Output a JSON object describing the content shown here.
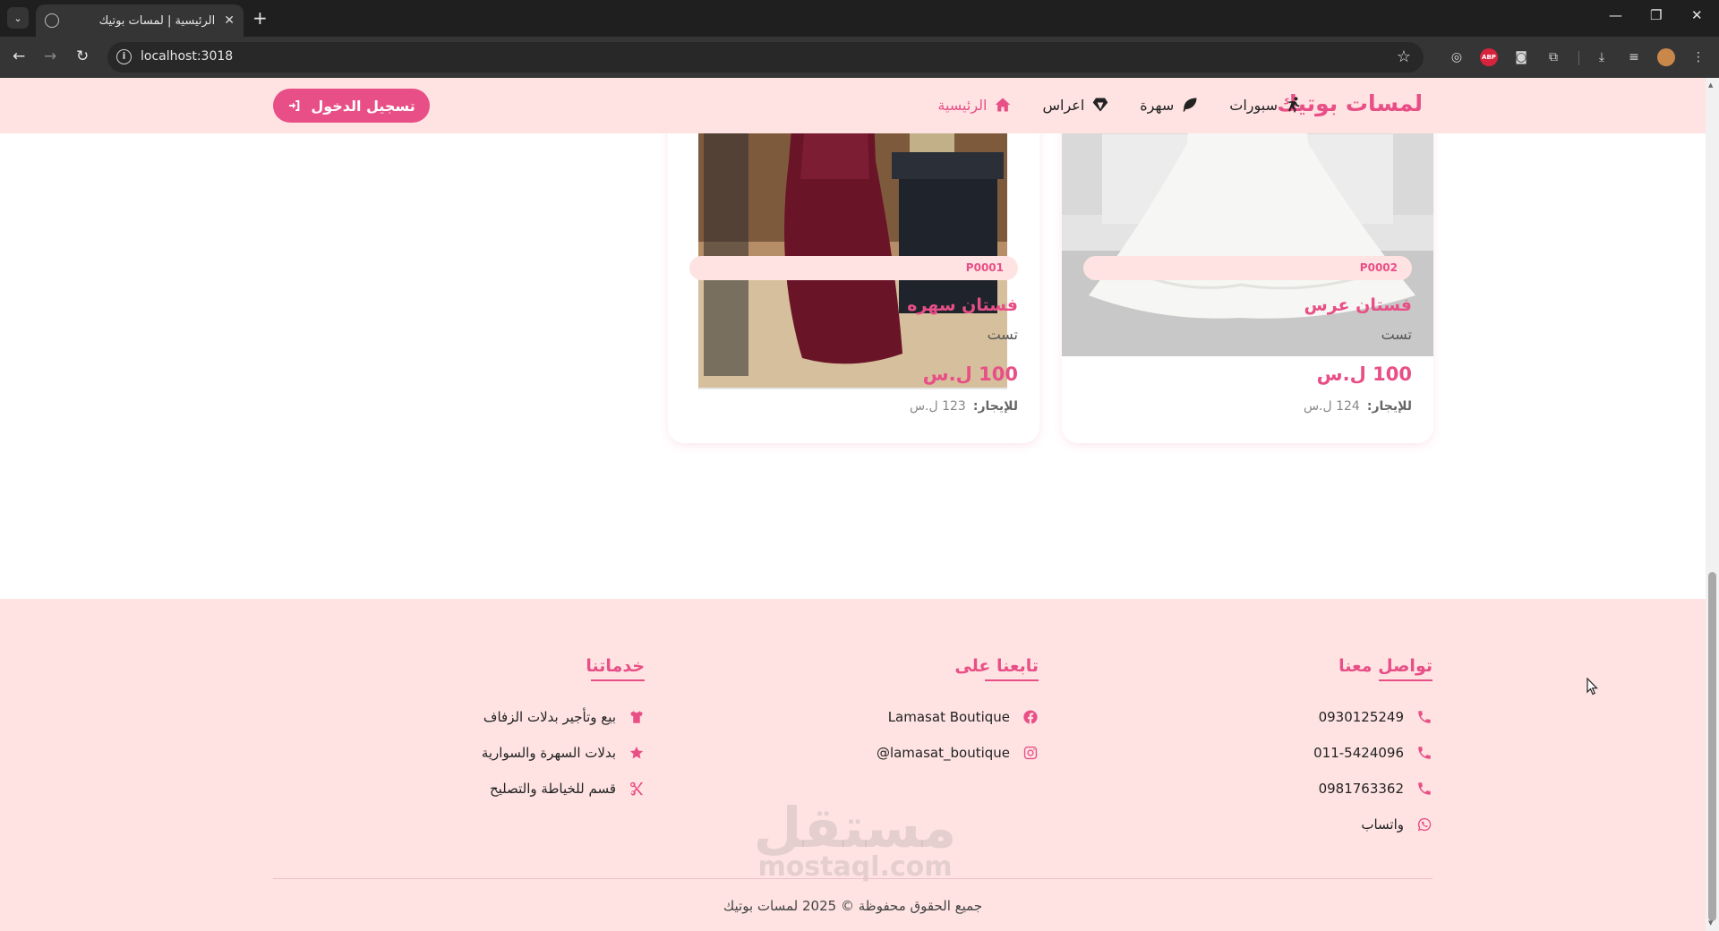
{
  "browser": {
    "tab_title": "الرئيسية | لمسات بوتيك",
    "url": "localhost:3018"
  },
  "header": {
    "brand": "لمسات بوتيك",
    "nav": [
      {
        "label": "الرئيسية",
        "icon": "home-icon",
        "active": true
      },
      {
        "label": "اعراس",
        "icon": "gem-icon",
        "active": false
      },
      {
        "label": "سهرة",
        "icon": "leaf-icon",
        "active": false
      },
      {
        "label": "سبورات",
        "icon": "running-icon",
        "active": false
      }
    ],
    "login_label": "تسجيل الدخول"
  },
  "products": [
    {
      "code": "P0002",
      "name": "فستان عرس",
      "description": "تست",
      "price": "100 ل.س",
      "rent_label": "للإيجار:",
      "rent_value": "124 ل.س"
    },
    {
      "code": "P0001",
      "name": "فستان سهره",
      "description": "تست",
      "price": "100 ل.س",
      "rent_label": "للإيجار:",
      "rent_value": "123 ل.س"
    }
  ],
  "footer": {
    "contact": {
      "title": "تواصل معنا",
      "items": [
        {
          "text": "0930125249",
          "icon": "phone-icon"
        },
        {
          "text": "011-5424096",
          "icon": "phone-icon"
        },
        {
          "text": "0981763362",
          "icon": "phone-icon"
        },
        {
          "text": "واتساب",
          "icon": "whatsapp-icon"
        }
      ]
    },
    "follow": {
      "title": "تابعنا على",
      "items": [
        {
          "text": "Lamasat Boutique",
          "icon": "facebook-icon"
        },
        {
          "text": "lamasat_boutique@",
          "icon": "instagram-icon"
        }
      ]
    },
    "services": {
      "title": "خدماتنا",
      "items": [
        {
          "text": "بيع وتأجير بدلات الزفاف",
          "icon": "shirt-icon"
        },
        {
          "text": "بدلات السهرة والسوارية",
          "icon": "star-icon"
        },
        {
          "text": "قسم للخياطة والتصليح",
          "icon": "scissors-icon"
        }
      ]
    },
    "copyright": "جميع الحقوق محفوظة © 2025 لمسات بوتيك"
  },
  "watermark": {
    "ar": "مستقل",
    "en": "mostaql.com"
  },
  "colors": {
    "accent": "#e84f86",
    "header_bg": "#ffe3e3",
    "chrome_dark": "#1f1f1f"
  }
}
